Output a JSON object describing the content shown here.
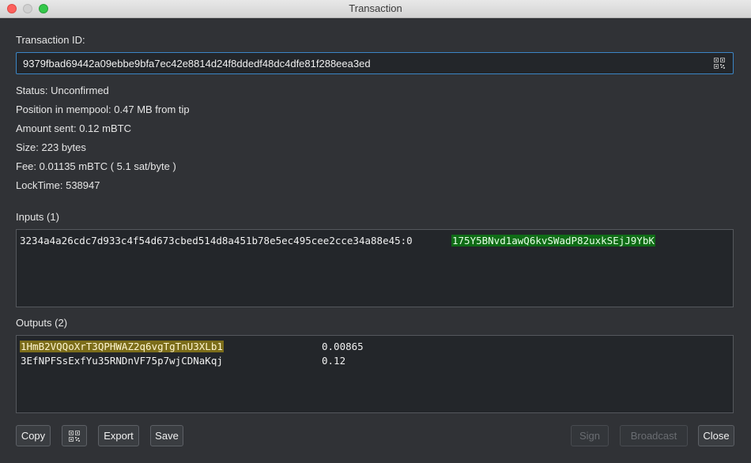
{
  "window": {
    "title": "Transaction"
  },
  "txid": {
    "label": "Transaction ID:",
    "value": "9379fbad69442a09ebbe9bfa7ec42e8814d24f8ddedf48dc4dfe81f288eea3ed"
  },
  "details": [
    "Status: Unconfirmed",
    "Position in mempool: 0.47 MB from tip",
    "Amount sent: 0.12 mBTC",
    "Size: 223 bytes",
    "Fee: 0.01135 mBTC  ( 5.1 sat/byte )",
    "LockTime: 538947"
  ],
  "inputs": {
    "label": "Inputs (1)",
    "items": [
      {
        "prevout": "3234a4a26cdc7d933c4f54d673cbed514d8a451b78e5ec495cee2cce34a88e45:0",
        "address": "175Y5BNvd1awQ6kvSWadP82uxkSEjJ9YbK"
      }
    ]
  },
  "outputs": {
    "label": "Outputs (2)",
    "items": [
      {
        "address": "1HmB2VQQoXrT3QPHWAZ2q6vgTgTnU3XLb1",
        "value": "0.00865",
        "highlight": "#7c6d1a"
      },
      {
        "address": "3EfNPFSsExfYu35RNDnVF75p7wjCDNaKqj",
        "value": "0.12",
        "highlight": ""
      }
    ]
  },
  "buttons": {
    "copy": "Copy",
    "qr": "qrcode-icon",
    "export": "Export",
    "save": "Save",
    "sign": "Sign",
    "broadcast": "Broadcast",
    "close": "Close"
  },
  "colors": {
    "input_highlight": "#0f6b16",
    "output_highlight": "#7c6d1a",
    "focus_border": "#3b86c6"
  }
}
